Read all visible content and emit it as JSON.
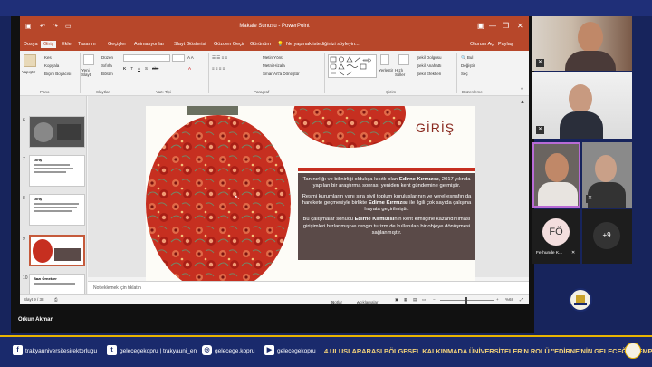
{
  "powerpoint": {
    "window_title": "Makale Sunusu - PowerPoint",
    "tabs": [
      "Dosya",
      "Giriş",
      "Ekle",
      "Tasarım",
      "Geçişler",
      "Animasyonlar",
      "Slayt Gösterisi",
      "Gözden Geçir",
      "Görünüm"
    ],
    "tell_me": "Ne yapmak istediğinizi söyleyin...",
    "account": "Oturum Aç",
    "share": "Paylaş",
    "ribbon": {
      "paste": "Yapıştır",
      "cut": "Kes",
      "copy": "Kopyala",
      "format_painter": "Biçim Boyacısı",
      "clipboard_group": "Pano",
      "new_slide": "Yeni Slayt",
      "layout": "Düzen",
      "reset": "Sıfırla",
      "section": "Bölüm",
      "slides_group": "Slaytlar",
      "font_group": "Yazı Tipi",
      "text_direction": "Metin Yönü",
      "align_text": "Metni Hizala",
      "smartart": "SmartArt'a Dönüştür",
      "paragraph_group": "Paragraf",
      "drawing_group": "Çizim",
      "arrange": "Yerleştir",
      "quick_styles": "Hızlı Stiller",
      "shape_fill": "Şekil Dolgusu",
      "shape_outline": "Şekil Anahattı",
      "shape_effects": "Şekil Efektleri",
      "find": "Bul",
      "replace": "Değiştir",
      "select": "Seç",
      "editing_group": "Düzenleme"
    },
    "thumbnails": [
      {
        "num": "6"
      },
      {
        "num": "7",
        "title": "Giriş"
      },
      {
        "num": "8",
        "title": "Giriş"
      },
      {
        "num": "9"
      },
      {
        "num": "10",
        "title": "Bazı Örnekler"
      }
    ],
    "slide": {
      "title": "GİRİŞ",
      "paragraph1_a": "Tanınırlığı ve bilinirliği oldukça kısıtlı olan ",
      "paragraph1_b": "Edirne Kırmızısı",
      "paragraph1_c": ", 2017 yılında yapılan bir araştırma sonrası yeniden kent gündemine gelmiştir.",
      "paragraph2_a": "Resmi kurumların yanı sıra sivil toplum kuruluşlarının ve yerel esnafın da harekete geçmesiyle birlikte ",
      "paragraph2_b": "Edirne Kırmızısı",
      "paragraph2_c": " ile ilgili çok sayıda çalışma hayata geçirilmiştir.",
      "paragraph3_a": "Bu çalışmalar sonucu ",
      "paragraph3_b": "Edirne Kırmızısı",
      "paragraph3_c": "nın kent kimliğine kazandırılması girişimleri hızlanmış ve rengin turizm de kullanılan bir objeye dönüşmesi sağlanmıştır."
    },
    "notes_placeholder": "Not eklemek için tıklatın",
    "status": {
      "slide_counter": "Slayt 9 / 38",
      "notes": "Notlar",
      "comments": "Açıklamalar",
      "zoom": "%68"
    }
  },
  "meeting": {
    "speaker_name": "Orkun Akman",
    "participant_initials": "FÖ",
    "participant_name": "Ferhunde K...",
    "more_count": "+9"
  },
  "footer": {
    "facebook": "trakyauniversitesirektorlugu",
    "twitter": "gelecegekopru | trakyauni_en",
    "instagram": "gelecege.kopru",
    "youtube": "gelecegekopru",
    "banner": "4.ULUSLARARASI BÖLGESEL KALKINMADA ÜNİVERSİTELERİN ROLÜ \"EDİRNE'NİN GELECEĞİ\" SEMPOZYUMU"
  },
  "colors": {
    "ppt_accent": "#b7472a",
    "footer_bg": "#1a2a6c",
    "slide_text_box": "#5a4a48",
    "pattern_red": "#c62f20"
  }
}
